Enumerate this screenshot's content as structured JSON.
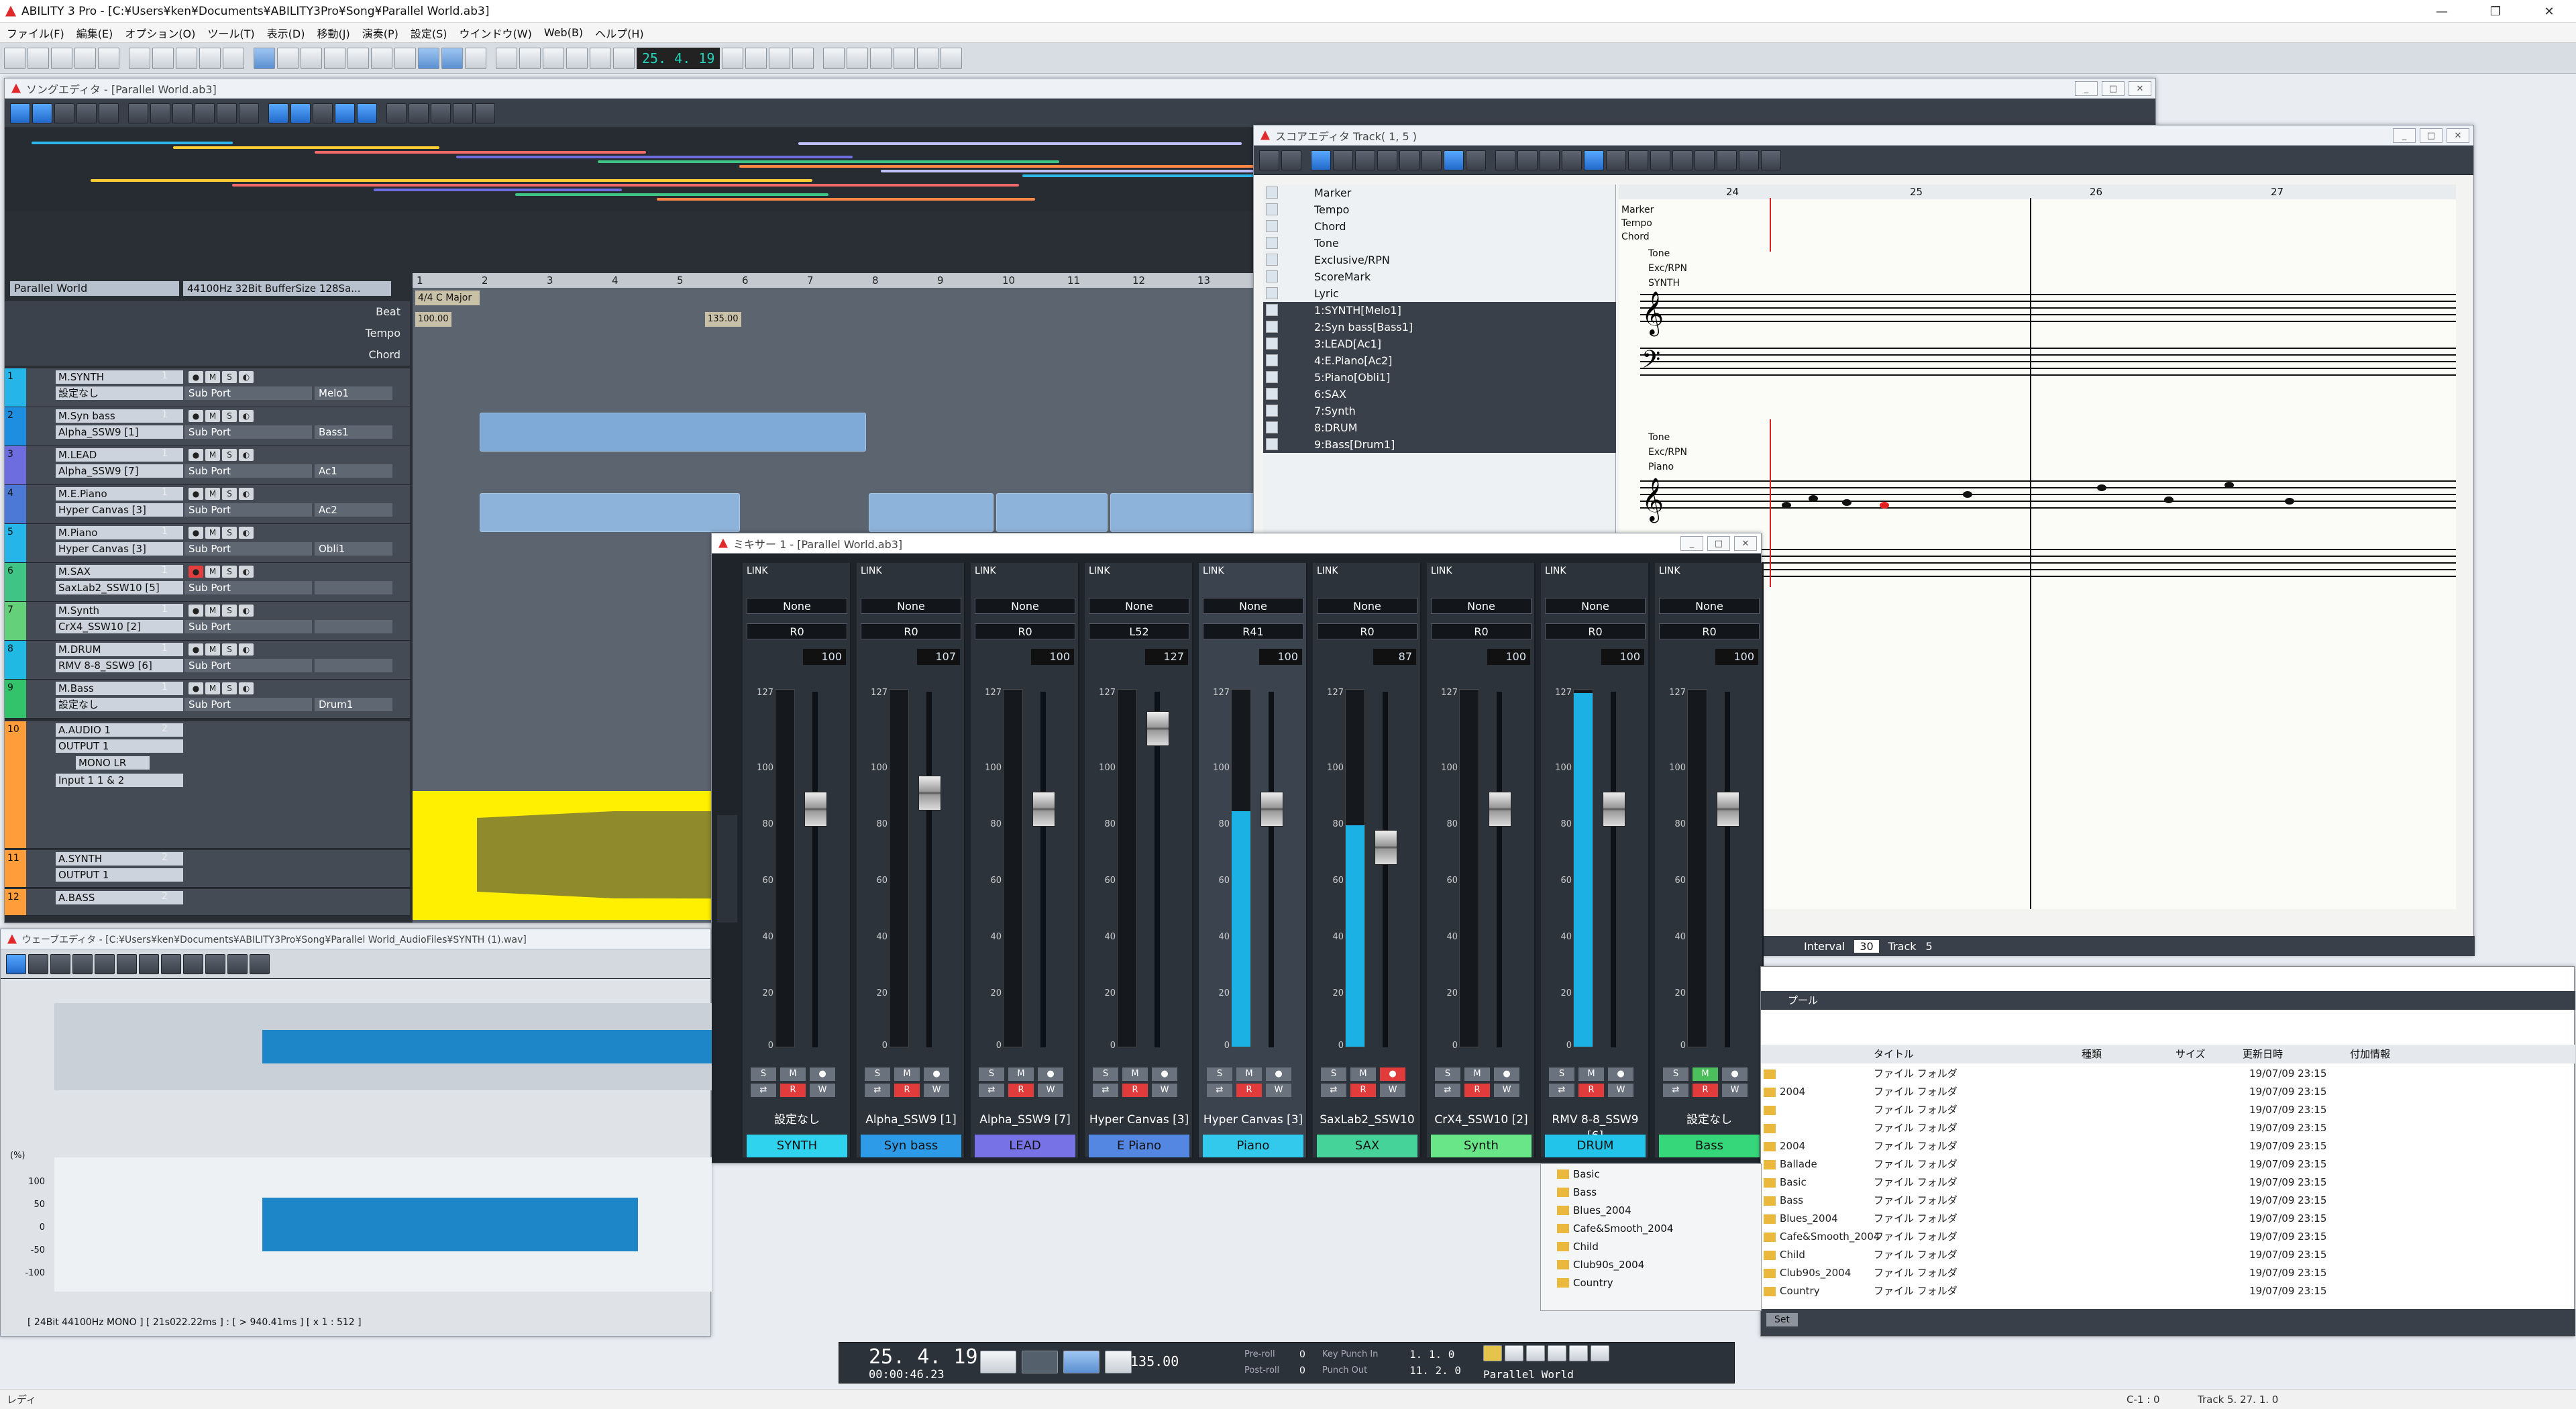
{
  "app": {
    "title": "ABILITY 3 Pro - [C:¥Users¥ken¥Documents¥ABILITY3Pro¥Song¥Parallel World.ab3]",
    "window_buttons": [
      "—",
      "❐",
      "✕"
    ]
  },
  "menu": [
    "ファイル(F)",
    "編集(E)",
    "オプション(O)",
    "ツール(T)",
    "表示(D)",
    "移動(J)",
    "演奏(P)",
    "設定(S)",
    "ウインドウ(W)",
    "Web(B)",
    "ヘルプ(H)"
  ],
  "main_toolbar": {
    "position": "25. 4. 19"
  },
  "song_editor": {
    "title": "ソングエディタ - [Parallel World.ab3]",
    "project": "Parallel World",
    "audio_info": "44100Hz 32Bit BufferSize 128Sa...",
    "row_labels": {
      "beat": "Beat",
      "tempo": "Tempo",
      "chord": "Chord"
    },
    "meter": "4/4 C Major",
    "tempo_markers": [
      "100.00",
      "135.00"
    ],
    "ruler": [
      "1",
      "2",
      "3",
      "4",
      "5",
      "6",
      "7",
      "8",
      "9",
      "10",
      "11",
      "12",
      "13"
    ],
    "tracks": [
      {
        "num": "1",
        "name": "M.SYNTH",
        "ch": "1",
        "sub": "設定なし",
        "port": "Sub Port",
        "inst": "Melo1",
        "color": "#26b5e8"
      },
      {
        "num": "2",
        "name": "M.Syn bass",
        "ch": "1",
        "sub": "Alpha_SSW9 [1]",
        "port": "Sub Port",
        "inst": "Bass1",
        "color": "#1e8fe0"
      },
      {
        "num": "3",
        "name": "M.LEAD",
        "ch": "1",
        "sub": "Alpha_SSW9 [7]",
        "port": "Sub Port",
        "inst": "Ac1",
        "color": "#6d6ddf"
      },
      {
        "num": "4",
        "name": "M.E.Piano",
        "ch": "1",
        "sub": "Hyper Canvas [3]",
        "port": "Sub Port",
        "inst": "Ac2",
        "color": "#4c79d6"
      },
      {
        "num": "5",
        "name": "M.Piano",
        "ch": "1",
        "sub": "Hyper Canvas [3]",
        "port": "Sub Port",
        "inst": "Obli1",
        "color": "#26b5e8"
      },
      {
        "num": "6",
        "name": "M.SAX",
        "ch": "1",
        "sub": "SaxLab2_SSW10 [5]",
        "port": "Sub Port",
        "inst": "",
        "color": "#3fc486"
      },
      {
        "num": "7",
        "name": "M.Synth",
        "ch": "1",
        "sub": "CrX4_SSW10 [2]",
        "port": "Sub Port",
        "inst": "",
        "color": "#65d07a"
      },
      {
        "num": "8",
        "name": "M.DRUM",
        "ch": "1",
        "sub": "RMV 8-8_SSW9 [6]",
        "port": "Sub Port",
        "inst": "",
        "color": "#1fb9e3"
      },
      {
        "num": "9",
        "name": "M.Bass",
        "ch": "1",
        "sub": "設定なし",
        "port": "Sub Port",
        "inst": "Drum1",
        "color": "#33c46b"
      }
    ],
    "audio_tracks": [
      {
        "num": "10",
        "name": "A.AUDIO 1",
        "ch": "2",
        "out": "OUTPUT 1",
        "mode": "MONO LR",
        "input": "Input 1 1 & 2"
      },
      {
        "num": "11",
        "name": "A.SYNTH",
        "ch": "2",
        "out": "OUTPUT 1"
      },
      {
        "num": "12",
        "name": "A.BASS",
        "ch": "2"
      }
    ]
  },
  "score_editor": {
    "title": "スコアエディタ Track( 1, 5 )",
    "list": [
      "Marker",
      "Tempo",
      "Chord",
      "Tone",
      "Exclusive/RPN",
      "ScoreMark",
      "Lyric",
      "1:SYNTH[Melo1]",
      "2:Syn bass[Bass1]",
      "3:LEAD[Ac1]",
      "4:E.Piano[Ac2]",
      "5:Piano[Obli1]",
      "6:SAX",
      "7:Synth",
      "8:DRUM",
      "9:Bass[Drum1]"
    ],
    "row_labels": [
      "Marker",
      "Tempo",
      "Chord"
    ],
    "staff_labels_1": [
      "Tone",
      "Exc/RPN",
      "SYNTH"
    ],
    "staff_labels_2": [
      "Tone",
      "Exc/RPN",
      "Piano"
    ],
    "measures": [
      "24",
      "25",
      "26",
      "27"
    ],
    "interval_label": "Interval",
    "interval_value": "30",
    "track_label": "Track",
    "track_value": "5"
  },
  "mixer": {
    "title": "ミキサー 1 - [Parallel World.ab3]",
    "link_label": "LINK",
    "scale": [
      "127",
      "100",
      "80",
      "60",
      "40",
      "20",
      "0"
    ],
    "strips": [
      {
        "send": "None",
        "pan": "R0",
        "vol": "100",
        "level": 0.0,
        "fader": 0.69,
        "name": "設定なし",
        "tag": "SYNTH",
        "color": "#30d3ee"
      },
      {
        "send": "None",
        "pan": "R0",
        "vol": "107",
        "level": 0.0,
        "fader": 0.74,
        "name": "Alpha_SSW9 [1]",
        "tag": "Syn bass",
        "color": "#2e9be8"
      },
      {
        "send": "None",
        "pan": "R0",
        "vol": "100",
        "level": 0.0,
        "fader": 0.69,
        "name": "Alpha_SSW9 [7]",
        "tag": "LEAD",
        "color": "#7773e6"
      },
      {
        "send": "None",
        "pan": "L52",
        "vol": "127",
        "level": 0.0,
        "fader": 0.94,
        "name": "Hyper Canvas [3]",
        "tag": "E Piano",
        "color": "#5487e2"
      },
      {
        "send": "None",
        "pan": "R41",
        "vol": "100",
        "level": 0.66,
        "fader": 0.69,
        "name": "Hyper Canvas [3]",
        "tag": "Piano",
        "color": "#32c9ec"
      },
      {
        "send": "None",
        "pan": "R0",
        "vol": "87",
        "level": 0.62,
        "fader": 0.57,
        "name": "SaxLab2_SSW10",
        "tag": "SAX",
        "color": "#45d39a"
      },
      {
        "send": "None",
        "pan": "R0",
        "vol": "100",
        "level": 0.0,
        "fader": 0.69,
        "name": "CrX4_SSW10 [2]",
        "tag": "Synth",
        "color": "#69e687"
      },
      {
        "send": "None",
        "pan": "R0",
        "vol": "100",
        "level": 0.99,
        "fader": 0.69,
        "name": "RMV 8-8_SSW9 [6]",
        "tag": "DRUM",
        "color": "#22c4ea"
      },
      {
        "send": "None",
        "pan": "R0",
        "vol": "100",
        "level": 0.0,
        "fader": 0.69,
        "name": "設定なし",
        "tag": "Bass",
        "color": "#36d67a"
      }
    ]
  },
  "wave_editor": {
    "title": "ウェーブエディタ - [C:¥Users¥ken¥Documents¥ABILITY3Pro¥Song¥Parallel World_AudioFiles¥SYNTH (1).wav]",
    "y_axis": [
      "100",
      "50",
      "0",
      "-50",
      "-100"
    ],
    "pct": "(%)",
    "info": "[ 24Bit  44100Hz  MONO ] [ 21s022.22ms ] : [ > 940.41ms ] [ x 1 : 512 ]"
  },
  "browser": {
    "tab": "プール",
    "headers": [
      "タイトル",
      "種類",
      "サイズ",
      "更新日時",
      "付加情報"
    ],
    "folders": [
      "Basic",
      "Bass",
      "Blues_2004",
      "Cafe&Smooth_2004",
      "Child",
      "Club90s_2004",
      "Country"
    ],
    "rows": [
      {
        "name": "",
        "type": "ファイル フォルダ",
        "date": "19/07/09 23:15"
      },
      {
        "name": "2004",
        "type": "ファイル フォルダ",
        "date": "19/07/09 23:15"
      },
      {
        "name": "",
        "type": "ファイル フォルダ",
        "date": "19/07/09 23:15"
      },
      {
        "name": "",
        "type": "ファイル フォルダ",
        "date": "19/07/09 23:15"
      },
      {
        "name": "2004",
        "type": "ファイル フォルダ",
        "date": "19/07/09 23:15"
      },
      {
        "name": "Ballade",
        "type": "ファイル フォルダ",
        "date": "19/07/09 23:15"
      },
      {
        "name": "Basic",
        "type": "ファイル フォルダ",
        "date": "19/07/09 23:15"
      },
      {
        "name": "Bass",
        "type": "ファイル フォルダ",
        "date": "19/07/09 23:15"
      },
      {
        "name": "Blues_2004",
        "type": "ファイル フォルダ",
        "date": "19/07/09 23:15"
      },
      {
        "name": "Cafe&Smooth_2004",
        "type": "ファイル フォルダ",
        "date": "19/07/09 23:15"
      },
      {
        "name": "Child",
        "type": "ファイル フォルダ",
        "date": "19/07/09 23:15"
      },
      {
        "name": "Club90s_2004",
        "type": "ファイル フォルダ",
        "date": "19/07/09 23:15"
      },
      {
        "name": "Country",
        "type": "ファイル フォルダ",
        "date": "19/07/09 23:15"
      }
    ],
    "set_label": "Set"
  },
  "transport": {
    "position": "25. 4. 19",
    "time": "00:00:46.23",
    "tempo": "135.00",
    "preroll_label": "Pre-roll",
    "postroll_label": "Post-roll",
    "preroll": "0",
    "postroll": "0",
    "key_label": "Key",
    "punch_in_label": "Punch In",
    "punch_out_label": "Punch Out",
    "punch_in": "1. 1. 0",
    "punch_out": "11. 2. 0",
    "song_name": "Parallel World"
  },
  "status": {
    "left": "レディ",
    "c": "C-1 : 0",
    "track": "Track  5. 27. 1. 0"
  }
}
